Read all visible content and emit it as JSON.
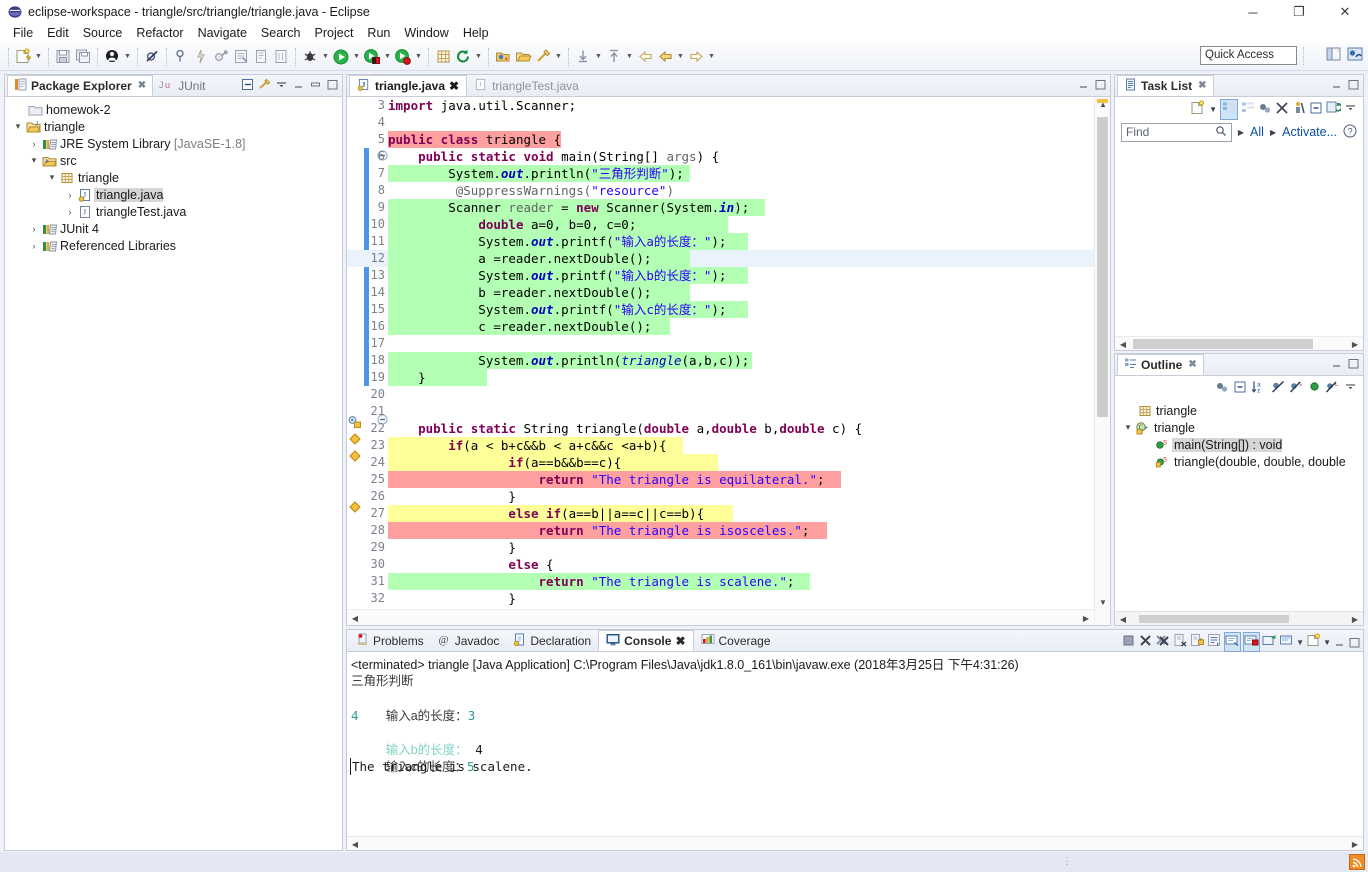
{
  "window": {
    "title": "eclipse-workspace - triangle/src/triangle/triangle.java - Eclipse",
    "app_icon": "eclipse-icon",
    "minimize": "─",
    "maximize": "❐",
    "close": "✕"
  },
  "menubar": {
    "items": [
      "File",
      "Edit",
      "Source",
      "Refactor",
      "Navigate",
      "Search",
      "Project",
      "Run",
      "Window",
      "Help"
    ]
  },
  "toolbar": {
    "quick_access_placeholder": "Quick Access",
    "quick_access_value": "Quick Access",
    "icons": [
      "new-wizard-icon",
      "save-icon",
      "save-all-icon",
      "new-java-class-icon",
      "skip-breakpoints-icon",
      "toggle-breakpoint-icon",
      "quick-fix-icon",
      "external-tools-icon",
      "open-type-icon",
      "open-task-icon",
      "search-icon",
      "debug-icon",
      "run-icon",
      "coverage-icon",
      "coverage-last-icon",
      "new-annotation-icon",
      "refresh-icon",
      "open-resource-icon",
      "open-folder-icon",
      "link-icon",
      "next-annotation-icon",
      "previous-annotation-icon",
      "back-icon",
      "forward-icon"
    ],
    "perspective_buttons": [
      "open-perspective-icon",
      "java-perspective-icon"
    ]
  },
  "package_explorer": {
    "tab_label": "Package Explorer",
    "tab_secondary": "JUnit",
    "tab_secondary_icon": "junit-icon",
    "controls": [
      "collapse-all-icon",
      "link-with-editor-icon",
      "view-menu-icon",
      "minimize-icon",
      "maximize-icon",
      "restore-icon"
    ],
    "tree": [
      {
        "label": "homewok-2",
        "icon": "closed-project-icon",
        "indent": 1,
        "twisty": "",
        "selected": false
      },
      {
        "label": "triangle",
        "icon": "java-project-icon",
        "indent": 0,
        "twisty": "▾",
        "selected": false
      },
      {
        "label": "JRE System Library",
        "suffix": " [JavaSE-1.8]",
        "icon": "library-icon",
        "indent": 1,
        "twisty": "›",
        "selected": false
      },
      {
        "label": "src",
        "icon": "source-folder-icon",
        "indent": 1,
        "twisty": "▾",
        "selected": false
      },
      {
        "label": "triangle",
        "icon": "package-icon",
        "indent": 2,
        "twisty": "▾",
        "selected": false
      },
      {
        "label": "triangle.java",
        "icon": "java-file-icon",
        "indent": 3,
        "twisty": "›",
        "selected": true
      },
      {
        "label": "triangleTest.java",
        "icon": "java-file-plain-icon",
        "indent": 3,
        "twisty": "›",
        "selected": false
      },
      {
        "label": "JUnit 4",
        "icon": "library-icon",
        "indent": 1,
        "twisty": "›",
        "selected": false
      },
      {
        "label": "Referenced Libraries",
        "icon": "library-icon",
        "indent": 1,
        "twisty": "›",
        "selected": false
      }
    ]
  },
  "editor": {
    "tabs": [
      {
        "label": "triangle.java",
        "icon": "java-file-icon",
        "active": true,
        "close": "✕"
      },
      {
        "label": "triangleTest.java",
        "icon": "java-file-plain-icon",
        "active": false,
        "close": ""
      }
    ],
    "controls": [
      "minimize-icon",
      "maximize-icon"
    ],
    "first_line": 3,
    "lines": [
      {
        "n": 3,
        "text": "import java.util.Scanner;",
        "hl": null,
        "marker": "",
        "fold": ""
      },
      {
        "n": 4,
        "text": "",
        "hl": null,
        "marker": "",
        "fold": ""
      },
      {
        "n": 5,
        "text": "public class triangle {",
        "hl": "red",
        "marker": "",
        "fold": ""
      },
      {
        "n": 6,
        "text": "    public static void main(String[] args) {",
        "hl": null,
        "marker": "",
        "fold": "⊖"
      },
      {
        "n": 7,
        "text": "        System.out.println(\"三角形判断\");",
        "hl": "green",
        "marker": "",
        "fold": ""
      },
      {
        "n": 8,
        "text": "         @SuppressWarnings(\"resource\")",
        "hl": null,
        "marker": "",
        "fold": ""
      },
      {
        "n": 9,
        "text": "        Scanner reader = new Scanner(System.in);",
        "hl": "green",
        "marker": "",
        "fold": ""
      },
      {
        "n": 10,
        "text": "            double a=0, b=0, c=0;",
        "hl": "green",
        "marker": "",
        "fold": ""
      },
      {
        "n": 11,
        "text": "            System.out.printf(\"输入a的长度：\");",
        "hl": "green",
        "marker": "",
        "fold": ""
      },
      {
        "n": 12,
        "text": "            a =reader.nextDouble();",
        "hl": "green-caret",
        "marker": "",
        "fold": ""
      },
      {
        "n": 13,
        "text": "            System.out.printf(\"输入b的长度：\");",
        "hl": "green",
        "marker": "",
        "fold": ""
      },
      {
        "n": 14,
        "text": "            b =reader.nextDouble();",
        "hl": "green",
        "marker": "",
        "fold": ""
      },
      {
        "n": 15,
        "text": "            System.out.printf(\"输入c的长度：\");",
        "hl": "green",
        "marker": "",
        "fold": ""
      },
      {
        "n": 16,
        "text": "            c =reader.nextDouble();",
        "hl": "green",
        "marker": "",
        "fold": ""
      },
      {
        "n": 17,
        "text": "",
        "hl": null,
        "marker": "",
        "fold": ""
      },
      {
        "n": 18,
        "text": "            System.out.println(triangle(a,b,c));",
        "hl": "green",
        "marker": "",
        "fold": ""
      },
      {
        "n": 19,
        "text": "    }",
        "hl": "green",
        "marker": "",
        "fold": ""
      },
      {
        "n": 20,
        "text": "",
        "hl": null,
        "marker": "",
        "fold": ""
      },
      {
        "n": 21,
        "text": "    public static String triangle(double a,double b,double c) {",
        "hl": null,
        "marker": "override-icon",
        "fold": "⊖"
      },
      {
        "n": 22,
        "text": "        if(a < b+c&&b < a+c&&c <a+b){",
        "hl": "yellow",
        "marker": "warning-diamond",
        "fold": ""
      },
      {
        "n": 23,
        "text": "                if(a==b&&b==c){",
        "hl": "yellow",
        "marker": "warning-diamond",
        "fold": ""
      },
      {
        "n": 24,
        "text": "                    return \"The triangle is equilateral.\";",
        "hl": "red",
        "marker": "",
        "fold": ""
      },
      {
        "n": 25,
        "text": "                }",
        "hl": null,
        "marker": "",
        "fold": ""
      },
      {
        "n": 26,
        "text": "                else if(a==b||a==c||c==b){",
        "hl": "yellow",
        "marker": "warning-diamond",
        "fold": ""
      },
      {
        "n": 27,
        "text": "                    return \"The triangle is isosceles.\";",
        "hl": "red",
        "marker": "",
        "fold": ""
      },
      {
        "n": 28,
        "text": "                }",
        "hl": null,
        "marker": "",
        "fold": ""
      },
      {
        "n": 29,
        "text": "                else {",
        "hl": null,
        "marker": "",
        "fold": ""
      },
      {
        "n": 30,
        "text": "                    return \"The triangle is scalene.\";",
        "hl": "green",
        "marker": "",
        "fold": ""
      },
      {
        "n": 31,
        "text": "                }",
        "hl": null,
        "marker": "",
        "fold": ""
      },
      {
        "n": 32,
        "text": "",
        "hl": null,
        "marker": "",
        "fold": ""
      }
    ],
    "colors": {
      "highlight_green": "#b3ffb3",
      "highlight_red": "#ffa0a0",
      "highlight_yellow": "#ffff99",
      "keyword": "#7f0055",
      "string": "#2a00ff",
      "field": "#0000c0",
      "annotation": "#646464",
      "changebar": "#4d97e8"
    }
  },
  "task_list": {
    "tab_label": "Task List",
    "tab_icon": "tasklist-icon",
    "close": "✕",
    "find_placeholder": "Find",
    "find_value": "Find",
    "search_icon": "magnifier-icon",
    "all_label": "All",
    "activate_label": "Activate...",
    "help_icon": "help-icon",
    "toolbar_icons": [
      "new-task-icon",
      "categorized-icon",
      "scheduled-icon",
      "focus-icon",
      "filter-icon",
      "presentation-icon",
      "collapse-all-icon",
      "synchronize-icon",
      "view-menu-icon"
    ],
    "controls": [
      "minimize-icon",
      "maximize-icon"
    ]
  },
  "outline": {
    "tab_label": "Outline",
    "tab_icon": "outline-icon",
    "close": "✕",
    "toolbar_icons": [
      "focus-icon",
      "collapse-all-icon",
      "sort-icon",
      "hide-fields-icon",
      "hide-static-icon",
      "hide-nonpublic-icon",
      "hide-local-icon",
      "view-menu-icon"
    ],
    "controls": [
      "minimize-icon",
      "maximize-icon"
    ],
    "tree": [
      {
        "label": "triangle",
        "icon": "package-icon",
        "indent": 1,
        "twisty": "",
        "selected": false
      },
      {
        "label": "triangle",
        "icon": "class-icon",
        "indent": 1,
        "twisty": "▾",
        "selected": false
      },
      {
        "label": "main(String[]) : void",
        "icon": "public-static-method-icon",
        "indent": 2,
        "twisty": "",
        "selected": true
      },
      {
        "label": "triangle(double, double, double",
        "icon": "default-static-method-icon",
        "indent": 2,
        "twisty": "",
        "selected": false
      }
    ]
  },
  "console": {
    "tabs": [
      {
        "label": "Problems",
        "icon": "problems-icon",
        "active": false
      },
      {
        "label": "Javadoc",
        "icon": "javadoc-icon",
        "active": false
      },
      {
        "label": "Declaration",
        "icon": "declaration-icon",
        "active": false
      },
      {
        "label": "Console",
        "icon": "console-icon",
        "active": true,
        "close": "✕"
      },
      {
        "label": "Coverage",
        "icon": "coverage-icon",
        "active": false
      }
    ],
    "toolbar_icons": [
      "terminate-icon",
      "remove-launch-icon",
      "remove-all-launches-icon",
      "clear-console-icon",
      "scroll-lock-icon",
      "word-wrap-icon",
      "show-console-on-output-icon",
      "pin-console-icon",
      "display-selected-console-icon",
      "open-console-icon",
      "new-console-view-icon",
      "view-menu-icon",
      "minimize-icon",
      "maximize-icon"
    ],
    "header": "<terminated> triangle [Java Application] C:\\Program Files\\Java\\jdk1.8.0_161\\bin\\javaw.exe (2018年3月25日 下午4:31:26)",
    "output": [
      {
        "text": "三角形判断",
        "color": "#3c3c3c"
      },
      {
        "segments": [
          {
            "text": "输入a的长度：",
            "color": "#3c3c3c"
          },
          {
            "text": "3",
            "color": "#2a9d8f"
          }
        ]
      },
      {
        "text": "4",
        "color": "#2a9d8f"
      },
      {
        "segments": [
          {
            "text": "输入b的长度：",
            "color": "#7fd3c4"
          },
          {
            "text": " 4",
            "color": "#1a1a1a"
          }
        ]
      },
      {
        "segments": [
          {
            "text": "输入c的长度：",
            "color": "#3c3c3c"
          },
          {
            "text": "5",
            "color": "#2a9d8f"
          }
        ]
      },
      {
        "text": "The triangle is scalene.",
        "color": "#1a1a1a"
      }
    ]
  },
  "statusbar": {
    "grip": "⋮",
    "rss_icon": "rss-icon"
  }
}
